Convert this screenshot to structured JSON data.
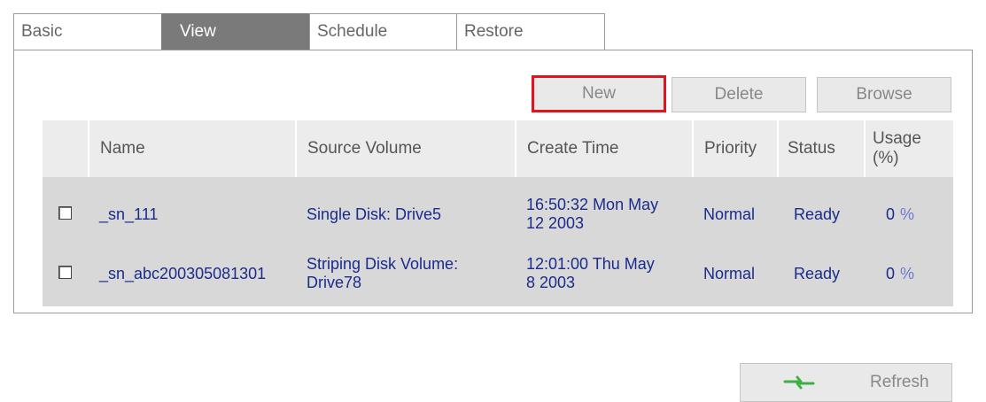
{
  "tabs": [
    {
      "label": "Basic"
    },
    {
      "label": "View"
    },
    {
      "label": "Schedule"
    },
    {
      "label": "Restore"
    }
  ],
  "active_tab": "View",
  "toolbar": {
    "new_label": "New",
    "delete_label": "Delete",
    "browse_label": "Browse"
  },
  "table": {
    "headers": {
      "name": "Name",
      "source": "Source Volume",
      "create_time": "Create Time",
      "priority": "Priority",
      "status": "Status",
      "usage_line1": "Usage",
      "usage_line2": "(%)"
    },
    "rows": [
      {
        "name": "_sn_111",
        "source": "Single Disk: Drive5",
        "create_time_line1": "16:50:32 Mon May",
        "create_time_line2": "12 2003",
        "priority": "Normal",
        "status": "Ready",
        "usage": "0",
        "usage_unit": "%"
      },
      {
        "name": "_sn_abc200305081301",
        "source_line1": "Striping Disk Volume:",
        "source_line2": "Drive78",
        "create_time_line1": "12:01:00 Thu May",
        "create_time_line2": "8 2003",
        "priority": "Normal",
        "status": "Ready",
        "usage": "0",
        "usage_unit": "%"
      }
    ]
  },
  "footer": {
    "refresh_label": "Refresh",
    "refresh_icon": "refresh-arrows-icon"
  },
  "colors": {
    "active_tab_bg": "#7a7a7a",
    "highlight_border": "#e0141e",
    "link_text": "#1a2b8c",
    "refresh_icon": "#3cb043"
  }
}
